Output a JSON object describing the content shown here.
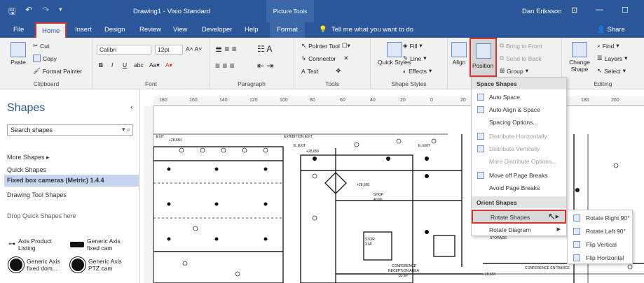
{
  "titlebar": {
    "doc_title": "Drawing1 - Visio Standard",
    "context_title": "Picture Tools",
    "user": "Dan Eriksson"
  },
  "tabs": [
    {
      "label": "File"
    },
    {
      "label": "Home"
    },
    {
      "label": "Insert"
    },
    {
      "label": "Design"
    },
    {
      "label": "Review"
    },
    {
      "label": "View"
    },
    {
      "label": "Developer"
    },
    {
      "label": "Help"
    },
    {
      "label": "Format"
    }
  ],
  "tellme": "Tell me what you want to do",
  "share": "Share",
  "ribbon": {
    "clipboard": {
      "paste": "Paste",
      "cut": "Cut",
      "copy": "Copy",
      "format_painter": "Format Painter",
      "label": "Clipboard"
    },
    "font": {
      "font_name": "Calibri",
      "font_size": "12pt",
      "label": "Font"
    },
    "paragraph": {
      "label": "Paragraph"
    },
    "tools": {
      "pointer": "Pointer Tool",
      "connector": "Connector",
      "text": "Text",
      "label": "Tools"
    },
    "shape_styles": {
      "quick_styles": "Quick Styles",
      "fill": "Fill",
      "line": "Line",
      "effects": "Effects",
      "label": "Shape Styles"
    },
    "arrange": {
      "align": "Align",
      "position": "Position",
      "bring_front": "Bring to Front",
      "send_back": "Send to Back",
      "group": "Group"
    },
    "editing": {
      "change_shape": "Change Shape",
      "find": "Find",
      "layers": "Layers",
      "select": "Select",
      "label": "Editing"
    }
  },
  "shapes_pane": {
    "title": "Shapes",
    "search_placeholder": "Search shapes",
    "items": [
      "More Shapes",
      "Quick Shapes",
      "Fixed box cameras (Metric) 1.4.4",
      "Drawing Tool Shapes"
    ],
    "drop_hint": "Drop Quick Shapes here",
    "stencils": [
      "Axis Product Listing",
      "Generic Axis fixed cam",
      "Generic Axis fixed dom...",
      "Generic Axis PTZ cam"
    ]
  },
  "ruler": [
    "180",
    "160",
    "140",
    "120",
    "100",
    "80",
    "60",
    "40",
    "20",
    "0",
    "20",
    "40",
    "60",
    "160",
    "180",
    "200"
  ],
  "plan_labels": {
    "exit": "EXIT",
    "exit_elev": "+28,650",
    "exhibition_exit": "EXHIBITION EXIT",
    "e_exit_1": "E. EXIT",
    "e_exit_2": "E. EXIT",
    "shop": "SHOP",
    "shop_area": "40 M²",
    "elev_2": "+28,650",
    "elev_3": "+28,650",
    "conference": "CONFERENCE",
    "reception": "RECEPTION AREA",
    "conf_area": "33 M²",
    "storage": "STORAGE",
    "conf_entrance": "CONFERENCE ENTRANCE",
    "stor": "STOR",
    "stor_area": "3 M²",
    "elev_4": "+28,650"
  },
  "menu": {
    "space_header": "Space Shapes",
    "auto_space": "Auto Space",
    "auto_align_space": "Auto Align & Space",
    "spacing_options": "Spacing Options...",
    "distribute_h": "Distribute Horizontally",
    "distribute_v": "Distribute Vertically",
    "more_distribute": "More Distribute Options...",
    "move_off": "Move off Page Breaks",
    "avoid_breaks": "Avoid Page Breaks",
    "orient_header": "Orient Shapes",
    "rotate_shapes": "Rotate Shapes",
    "rotate_diagram": "Rotate Diagram"
  },
  "submenu": {
    "rotate_right": "Rotate Right 90°",
    "rotate_left": "Rotate Left 90°",
    "flip_vertical": "Flip Vertical",
    "flip_horizontal": "Flip Horizontal"
  },
  "colors": {
    "brand": "#2b579a",
    "highlight": "#d9342b"
  }
}
